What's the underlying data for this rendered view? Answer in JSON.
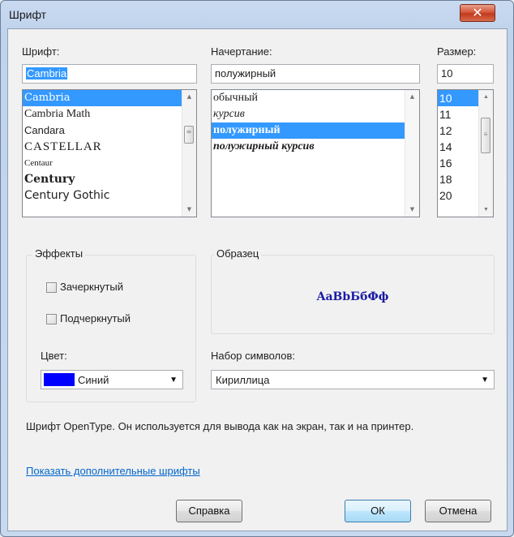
{
  "dialog": {
    "title": "Шрифт",
    "close_glyph": "✕"
  },
  "font": {
    "label": "Шрифт:",
    "value": "Cambria",
    "items": [
      "Cambria",
      "Cambria Math",
      "Candara",
      "CASTELLAR",
      "Centaur",
      "Century",
      "Century Gothic"
    ],
    "selected_index": 0
  },
  "style": {
    "label": "Начертание:",
    "value": "полужирный",
    "items": [
      "обычный",
      "курсив",
      "полужирный",
      "полужирный курсив"
    ],
    "selected_index": 2
  },
  "size": {
    "label": "Размер:",
    "value": "10",
    "items": [
      "10",
      "11",
      "12",
      "14",
      "16",
      "18",
      "20"
    ],
    "selected_index": 0
  },
  "effects": {
    "title": "Эффекты",
    "strikeout_label": "Зачеркнутый",
    "strikeout_checked": false,
    "underline_label": "Подчеркнутый",
    "underline_checked": false,
    "color_label": "Цвет:",
    "color_value": "Синий",
    "color_swatch": "#0000ff"
  },
  "sample": {
    "title": "Образец",
    "text": "AaBbБбФф",
    "color": "#1a1aa6"
  },
  "charset": {
    "label": "Набор символов:",
    "value": "Кириллица"
  },
  "description": "Шрифт OpenType. Он используется для вывода как на экран, так и на принтер.",
  "more_fonts_link": "Показать дополнительные шрифты",
  "buttons": {
    "help": "Справка",
    "ok": "ОК",
    "cancel": "Отмена"
  }
}
